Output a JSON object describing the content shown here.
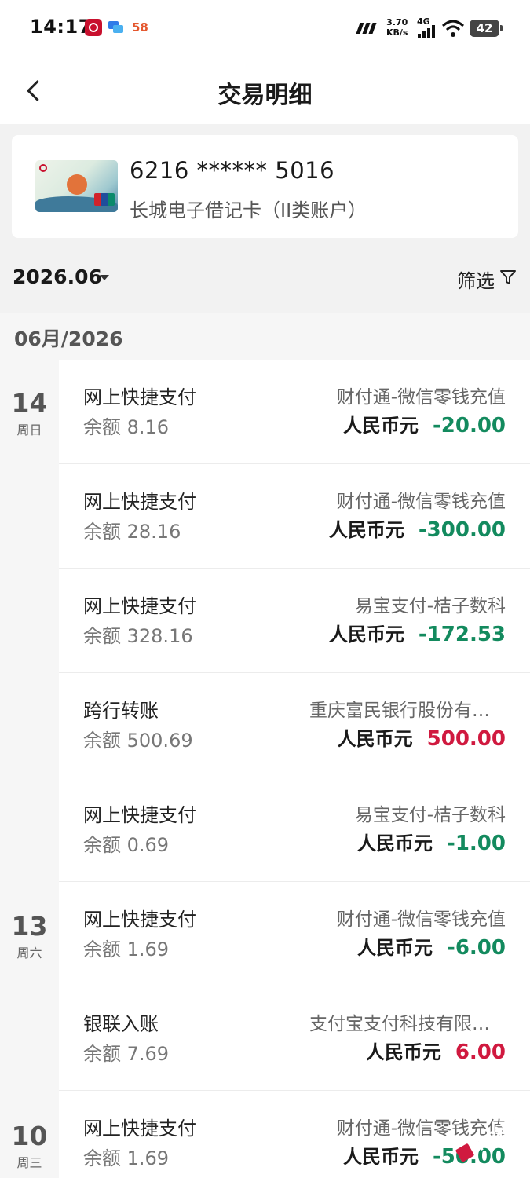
{
  "status_bar": {
    "time": "14:17",
    "app_58": "58",
    "net_speed_value": "3.70",
    "net_speed_unit": "KB/s",
    "network": "4G",
    "battery": "42"
  },
  "header": {
    "title": "交易明细"
  },
  "card": {
    "number": "6216 ****** 5016",
    "type": "长城电子借记卡（II类账户）"
  },
  "filter": {
    "month": "2026.06",
    "filter_label": "筛选"
  },
  "section": {
    "title": "06月/2026"
  },
  "dates": [
    {
      "day": "14",
      "weekday": "周日"
    },
    {
      "day": "13",
      "weekday": "周六"
    },
    {
      "day": "10",
      "weekday": "周三"
    }
  ],
  "transactions": [
    {
      "type": "网上快捷支付",
      "balance": "余额 8.16",
      "counterparty": "财付通-微信零钱充值",
      "currency": "人民币元",
      "amount": "-20.00",
      "direction": "out"
    },
    {
      "type": "网上快捷支付",
      "balance": "余额 28.16",
      "counterparty": "财付通-微信零钱充值",
      "currency": "人民币元",
      "amount": "-300.00",
      "direction": "out"
    },
    {
      "type": "网上快捷支付",
      "balance": "余额 328.16",
      "counterparty": "易宝支付-桔子数科",
      "currency": "人民币元",
      "amount": "-172.53",
      "direction": "out"
    },
    {
      "type": "跨行转账",
      "balance": "余额 500.69",
      "counterparty": "重庆富民银行股份有限公司",
      "currency": "人民币元",
      "amount": "500.00",
      "direction": "in"
    },
    {
      "type": "网上快捷支付",
      "balance": "余额 0.69",
      "counterparty": "易宝支付-桔子数科",
      "currency": "人民币元",
      "amount": "-1.00",
      "direction": "out"
    },
    {
      "type": "网上快捷支付",
      "balance": "余额 1.69",
      "counterparty": "财付通-微信零钱充值",
      "currency": "人民币元",
      "amount": "-6.00",
      "direction": "out"
    },
    {
      "type": "银联入账",
      "balance": "余额 7.69",
      "counterparty": "支付宝支付科技有限公司",
      "currency": "人民币元",
      "amount": "6.00",
      "direction": "in"
    },
    {
      "type": "网上快捷支付",
      "balance": "余额 1.69",
      "counterparty": "财付通-微信零钱充值",
      "currency": "人民币元",
      "amount": "-50.00",
      "direction": "out"
    }
  ],
  "watermark": {
    "text": "卡农社区"
  },
  "colors": {
    "amount_out": "#138a5e",
    "amount_in": "#d0193f"
  }
}
